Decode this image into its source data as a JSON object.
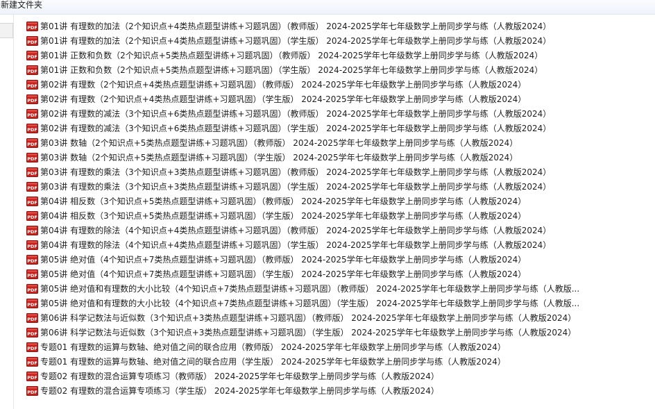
{
  "toolbar": {
    "new_folder_label": "新建文件夹"
  },
  "file_icon": "pdf-icon",
  "colors": {
    "icon_red": "#c8201b",
    "toolbar_bg": "#eef3fa"
  },
  "files": [
    {
      "name": "第01讲 有理数的加法（2个知识点+4类热点题型讲练+习题巩固）（教师版） 2024-2025学年七年级数学上册同步学与练（人教版2024）"
    },
    {
      "name": "第01讲 有理数的加法（2个知识点+4类热点题型讲练+习题巩固）（学生版） 2024-2025学年七年级数学上册同步学与练（人教版2024）"
    },
    {
      "name": "第01讲 正数和负数（2个知识点+5类热点题型讲练+习题巩固）（教师版） 2024-2025学年七年级数学上册同步学与练（人教版2024）"
    },
    {
      "name": "第01讲 正数和负数（2个知识点+5类热点题型讲练+习题巩固）（学生版） 2024-2025学年七年级数学上册同步学与练（人教版2024）"
    },
    {
      "name": "第02讲 有理数（2个知识点+4类热点题型讲练+习题巩固）（教师版） 2024-2025学年七年级数学上册同步学与练（人教版2024）"
    },
    {
      "name": "第02讲 有理数（2个知识点+4类热点题型讲练+习题巩固）（学生版） 2024-2025学年七年级数学上册同步学与练（人教版2024）"
    },
    {
      "name": "第02讲 有理数的减法（3个知识点+6类热点题型讲练+习题巩固）（教师版） 2024-2025学年七年级数学上册同步学与练（人教版2024）"
    },
    {
      "name": "第02讲 有理数的减法（3个知识点+6类热点题型讲练+习题巩固）（学生版） 2024-2025学年七年级数学上册同步学与练（人教版2024）"
    },
    {
      "name": "第03讲 数轴（2个知识点+5类热点题型讲练+习题巩固）（教师版） 2024-2025学年七年级数学上册同步学与练（人教版2024）"
    },
    {
      "name": "第03讲 数轴（2个知识点+5类热点题型讲练+习题巩固）（学生版） 2024-2025学年七年级数学上册同步学与练（人教版2024）"
    },
    {
      "name": "第03讲 有理数的乘法（3个知识点+3类热点题型讲练+习题巩固）（教师版） 2024-2025学年七年级数学上册同步学与练（人教版2024）"
    },
    {
      "name": "第03讲 有理数的乘法（3个知识点+3类热点题型讲练+习题巩固）（学生版） 2024-2025学年七年级数学上册同步学与练（人教版2024）"
    },
    {
      "name": "第04讲 相反数（3个知识点+5类热点题型讲练+习题巩固）（教师版） 2024-2025学年七年级数学上册同步学与练（人教版2024）"
    },
    {
      "name": "第04讲 相反数（3个知识点+5类热点题型讲练+习题巩固）（学生版） 2024-2025学年七年级数学上册同步学与练（人教版2024）"
    },
    {
      "name": "第04讲 有理数的除法（4个知识点+4类热点题型讲练+习题巩固）（教师版） 2024-2025学年七年级数学上册同步学与练（人教版2024）"
    },
    {
      "name": "第04讲 有理数的除法（4个知识点+4类热点题型讲练+习题巩固）（学生版） 2024-2025学年七年级数学上册同步学与练（人教版2024）"
    },
    {
      "name": "第05讲 绝对值（4个知识点+7类热点题型讲练+习题巩固）（教师版） 2024-2025学年七年级数学上册同步学与练（人教版2024）"
    },
    {
      "name": "第05讲 绝对值（4个知识点+7类热点题型讲练+习题巩固）（学生版） 2024-2025学年七年级数学上册同步学与练（人教版2024）"
    },
    {
      "name": "第05讲 绝对值和有理数的大小比较（4个知识点+7类热点题型讲练+习题巩固）（教师版） 2024-2025学年七年级数学上册同步学与练（人教版..."
    },
    {
      "name": "第05讲 绝对值和有理数的大小比较（4个知识点+7类热点题型讲练+习题巩固）（学生版） 2024-2025学年七年级数学上册同步学与练（人教版..."
    },
    {
      "name": "第06讲 科学记数法与近似数（3个知识点+3类热点题型讲练+习题巩固）（教师版） 2024-2025学年七年级数学上册同步学与练（人教版2024）"
    },
    {
      "name": "第06讲 科学记数法与近似数（3个知识点+3类热点题型讲练+习题巩固）（学生版） 2024-2025学年七年级数学上册同步学与练（人教版2024）"
    },
    {
      "name": "专题01 有理数的运算与数轴、绝对值之间的联合应用（教师版） 2024-2025学年七年级数学上册同步学与练（人教版2024）"
    },
    {
      "name": "专题01 有理数的运算与数轴、绝对值之间的联合应用（学生版） 2024-2025学年七年级数学上册同步学与练（人教版2024）"
    },
    {
      "name": "专题02 有理数的混合运算专项练习（教师版） 2024-2025学年七年级数学上册同步学与练（人教版2024）"
    },
    {
      "name": "专题02 有理数的混合运算专项练习（学生版） 2024-2025学年七年级数学上册同步学与练（人教版2024）"
    }
  ]
}
